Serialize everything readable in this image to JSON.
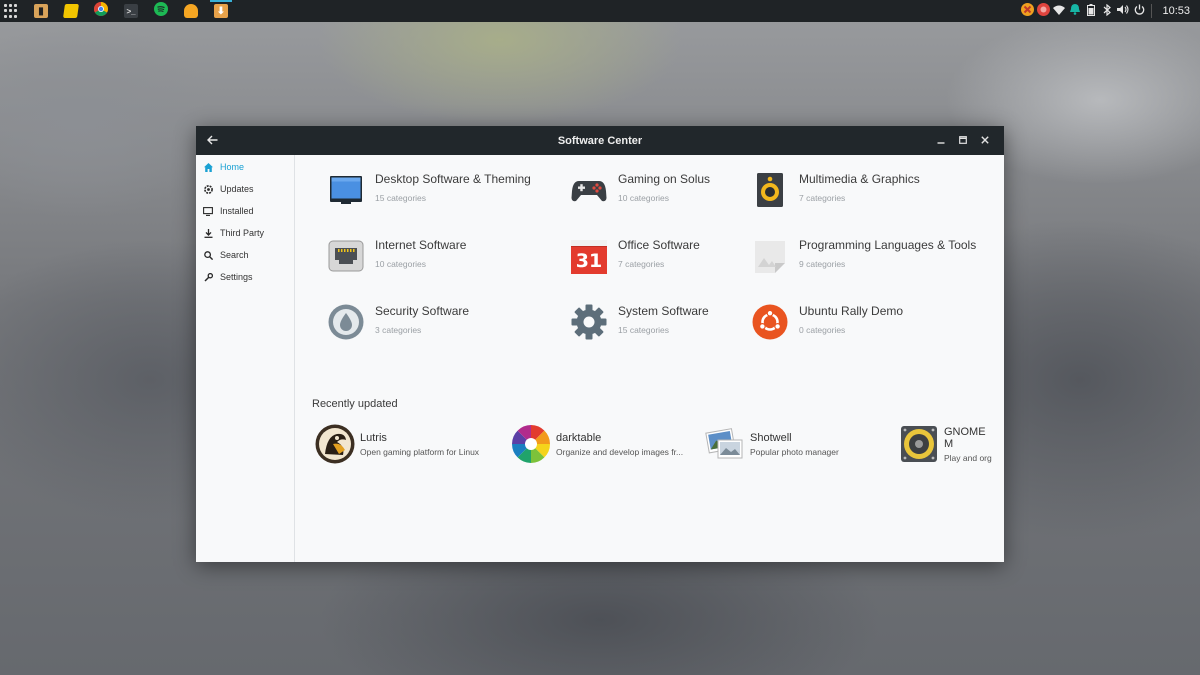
{
  "panel": {
    "clock": "10:53",
    "taskbar_icons": [
      "archive-icon",
      "sticky-notes-icon",
      "chrome-icon",
      "terminal-icon",
      "spotify-icon",
      "cheese-icon",
      "software-center-icon"
    ],
    "tray_icons": [
      "x-app-icon",
      "red-app-icon",
      "wifi-icon",
      "notification-icon",
      "battery-icon",
      "bluetooth-icon",
      "volume-icon",
      "power-icon"
    ]
  },
  "window": {
    "title": "Software Center"
  },
  "sidebar": {
    "items": [
      {
        "label": "Home",
        "icon": "home-icon",
        "active": true
      },
      {
        "label": "Updates",
        "icon": "updates-icon",
        "active": false
      },
      {
        "label": "Installed",
        "icon": "monitor-icon",
        "active": false
      },
      {
        "label": "Third Party",
        "icon": "download-icon",
        "active": false
      },
      {
        "label": "Search",
        "icon": "search-icon",
        "active": false
      },
      {
        "label": "Settings",
        "icon": "settings-icon",
        "active": false
      }
    ]
  },
  "categories": [
    {
      "name": "Desktop Software & Theming",
      "count": "15 categories",
      "icon": "desktop-icon"
    },
    {
      "name": "Gaming on Solus",
      "count": "10 categories",
      "icon": "gamepad-icon"
    },
    {
      "name": "Multimedia & Graphics",
      "count": "7 categories",
      "icon": "speaker-icon"
    },
    {
      "name": "Internet Software",
      "count": "10 categories",
      "icon": "network-port-icon"
    },
    {
      "name": "Office Software",
      "count": "7 categories",
      "icon": "calendar-icon",
      "calendar_day": "31"
    },
    {
      "name": "Programming Languages & Tools",
      "count": "9 categories",
      "icon": "file-icon"
    },
    {
      "name": "Security Software",
      "count": "3 categories",
      "icon": "security-icon"
    },
    {
      "name": "System Software",
      "count": "15 categories",
      "icon": "gear-icon"
    },
    {
      "name": "Ubuntu Rally Demo",
      "count": "0 categories",
      "icon": "ubuntu-icon"
    }
  ],
  "recent": {
    "title": "Recently updated",
    "apps": [
      {
        "name": "Lutris",
        "desc": "Open gaming platform for Linux",
        "icon": "lutris-icon"
      },
      {
        "name": "darktable",
        "desc": "Organize and develop images fr...",
        "icon": "darktable-icon"
      },
      {
        "name": "Shotwell",
        "desc": "Popular photo manager",
        "icon": "shotwell-icon"
      },
      {
        "name": "GNOME M",
        "desc": "Play and org",
        "icon": "gnome-music-icon"
      }
    ]
  },
  "colors": {
    "accent": "#1aa1d3",
    "titlebar": "#21272b",
    "panel": "#1f2326"
  }
}
